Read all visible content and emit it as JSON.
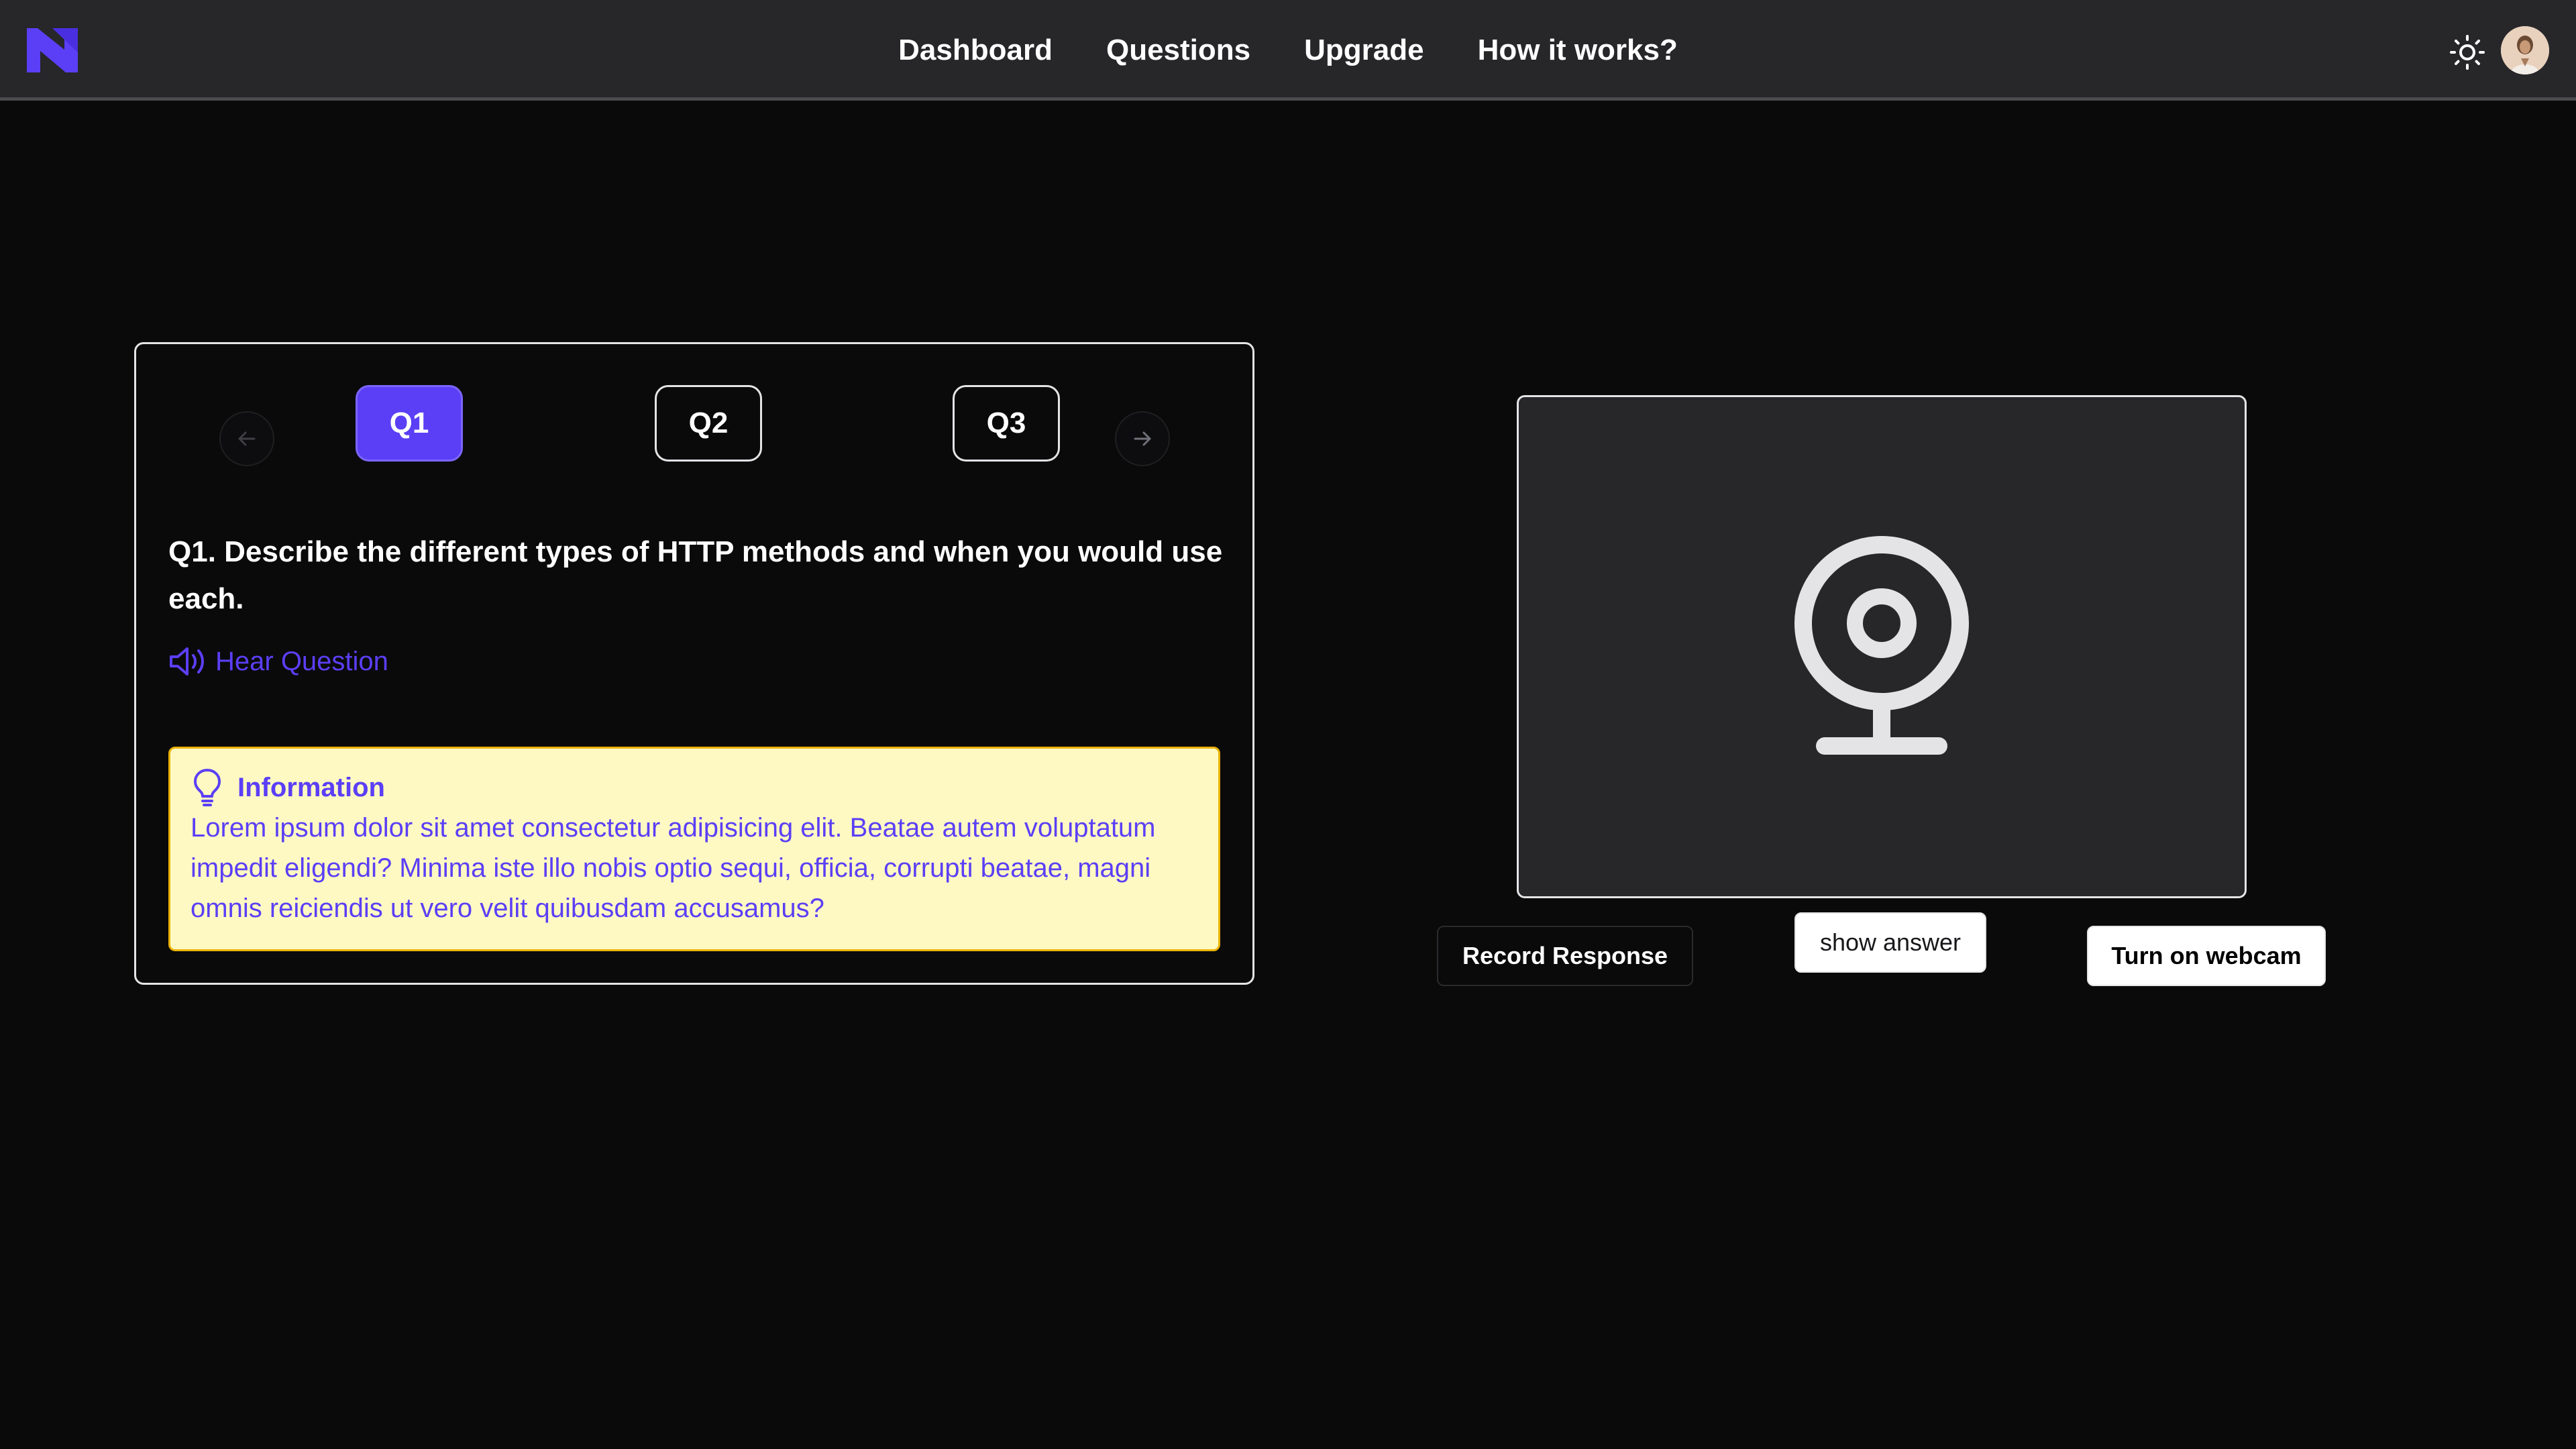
{
  "navbar": {
    "links": [
      "Dashboard",
      "Questions",
      "Upgrade",
      "How it works?"
    ],
    "logo_icon": "brand-logo-icon",
    "theme_icon": "sun-icon",
    "avatar_icon": "user-avatar"
  },
  "question_nav": {
    "tabs": [
      "Q1",
      "Q2",
      "Q3"
    ],
    "active_tab": "Q1"
  },
  "question": {
    "text": "Q1. Describe the different types of HTTP methods and when you would use each.",
    "hear_label": "Hear Question"
  },
  "info": {
    "title": "Information",
    "body": "Lorem ipsum dolor sit amet consectetur adipisicing elit. Beatae autem voluptatum impedit eligendi? Minima iste illo nobis optio sequi, officia, corrupti beatae, magni omnis reiciendis ut vero velit quibusdam accusamus?"
  },
  "actions": {
    "record_label": "Record Response",
    "show_answer_label": "show answer",
    "webcam_label": "Turn on webcam"
  },
  "colors": {
    "accent": "#5b3ff6",
    "navbar_bg": "#27272a",
    "page_bg": "#0a0a0a",
    "info_bg": "#fef9c3",
    "info_border": "#eab308"
  }
}
